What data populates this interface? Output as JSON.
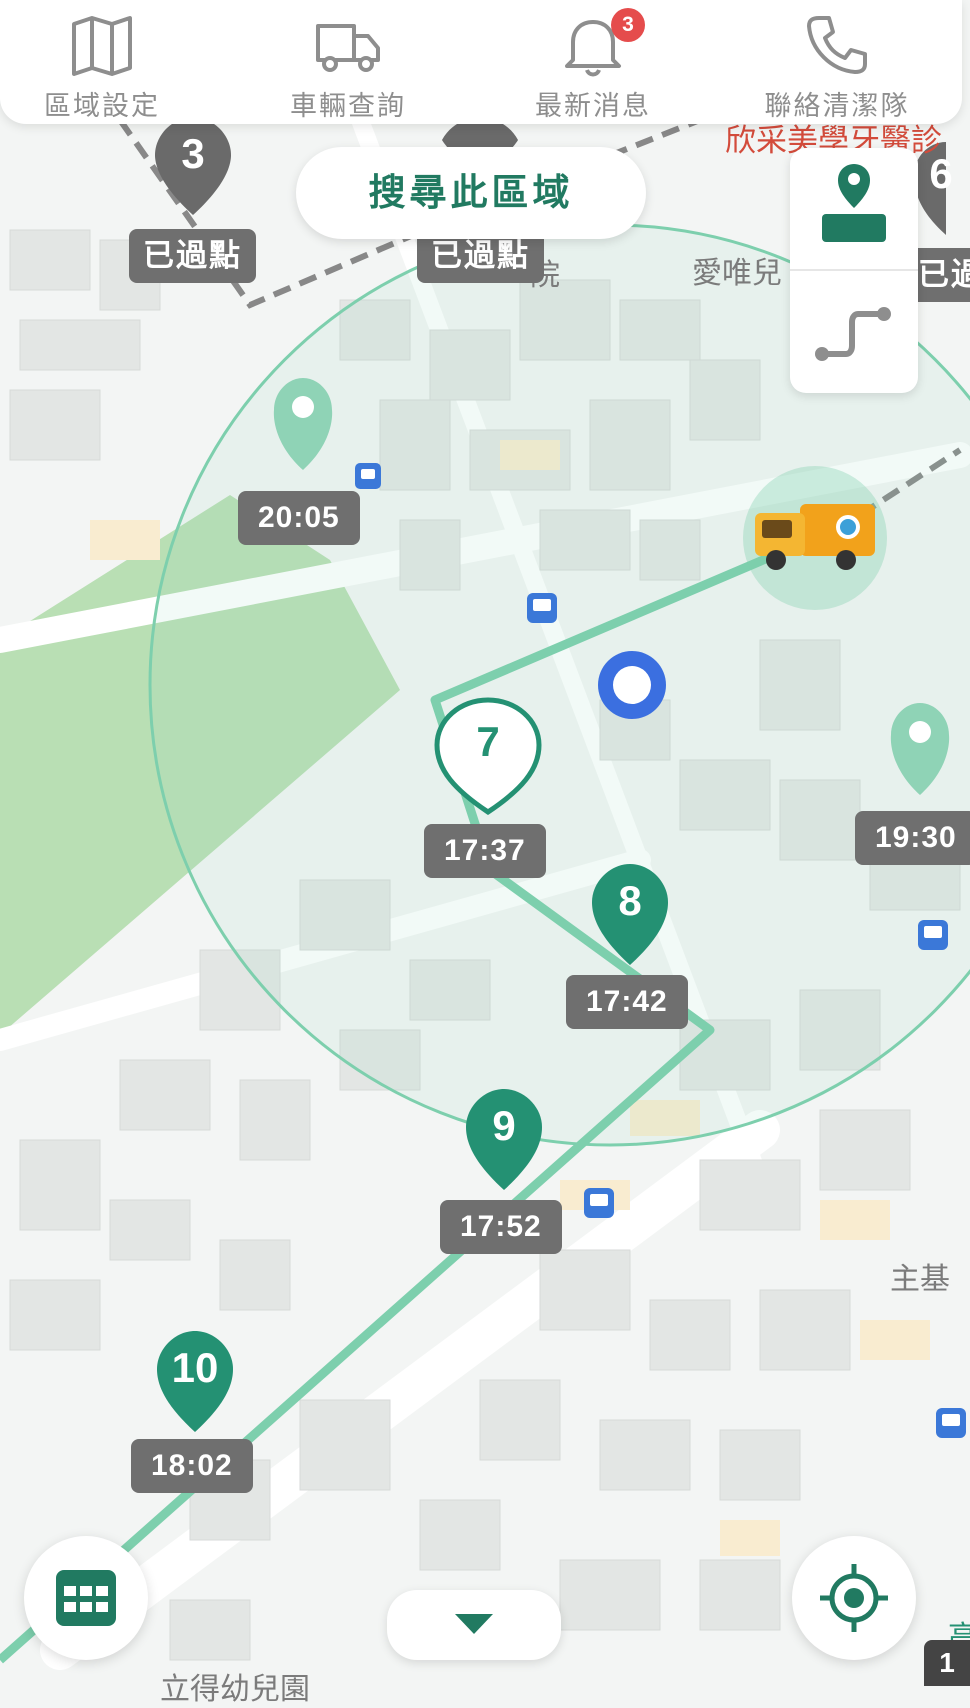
{
  "nav": {
    "items": [
      {
        "label": "區域設定",
        "icon": "map-icon"
      },
      {
        "label": "車輛查詢",
        "icon": "truck-icon"
      },
      {
        "label": "最新消息",
        "icon": "bell-icon",
        "badge": "3"
      },
      {
        "label": "聯絡清潔隊",
        "icon": "phone-icon"
      }
    ]
  },
  "search_area_label": "搜尋此區域",
  "map": {
    "place_labels": {
      "top_right": "欣采美學牙醫診",
      "left_mid": "愛唯兒",
      "right_bottom": "主基",
      "top_mid": "院",
      "bottom_left": "立得幼兒園",
      "bottom_right_partial": "高"
    },
    "passed_stops": [
      {
        "number": "3",
        "label": "已過點"
      },
      {
        "label": "已過點"
      },
      {
        "number": "6",
        "label": "已過"
      }
    ],
    "upcoming_stops": [
      {
        "number": "7",
        "time": "17:37",
        "style": "outline"
      },
      {
        "number": "8",
        "time": "17:42",
        "style": "filled"
      },
      {
        "number": "9",
        "time": "17:52",
        "style": "filled"
      },
      {
        "number": "10",
        "time": "18:02",
        "style": "filled"
      }
    ],
    "other_points": [
      {
        "time": "20:05"
      },
      {
        "time": "19:30"
      }
    ],
    "corner_chip": "1"
  },
  "colors": {
    "brand": "#217a61",
    "route": "#7dcfad",
    "pin": "#249173",
    "pass_label": "#6f6f6f",
    "badge": "#e54c4c",
    "user_dot": "#3b6fe0"
  }
}
